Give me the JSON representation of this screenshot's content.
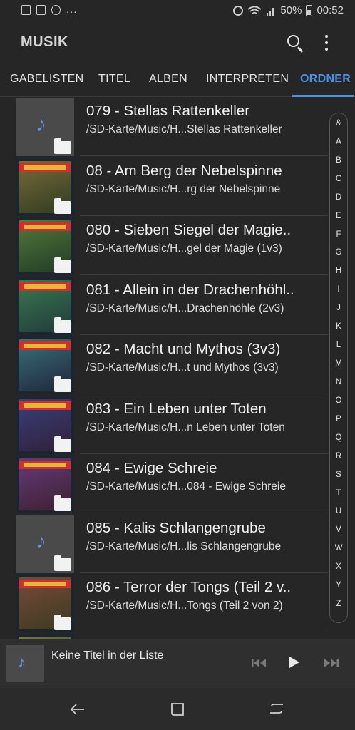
{
  "status_bar": {
    "battery": "50%",
    "time": "00:52",
    "more": "..."
  },
  "app": {
    "title": "MUSIK"
  },
  "tabs": [
    {
      "label": "GABELISTEN"
    },
    {
      "label": "TITEL"
    },
    {
      "label": "ALBEN"
    },
    {
      "label": "INTERPRETEN"
    },
    {
      "label": "ORDNER"
    }
  ],
  "active_tab": "ORDNER",
  "folders": [
    {
      "title": "079 - Stellas Rattenkeller",
      "path": "/SD-Karte/Music/H...Stellas Rattenkeller",
      "art": "note"
    },
    {
      "title": "08 - Am Berg der Nebelspinne",
      "path": "/SD-Karte/Music/H...rg der Nebelspinne",
      "art": "cover"
    },
    {
      "title": "080 - Sieben Siegel der Magie..",
      "path": "/SD-Karte/Music/H...gel der Magie (1v3)",
      "art": "cover"
    },
    {
      "title": "081 - Allein in der Drachenhöhl..",
      "path": "/SD-Karte/Music/H...Drachenhöhle (2v3)",
      "art": "cover"
    },
    {
      "title": "082 - Macht und Mythos (3v3)",
      "path": "/SD-Karte/Music/H...t und Mythos (3v3)",
      "art": "cover"
    },
    {
      "title": "083 - Ein Leben unter Toten",
      "path": "/SD-Karte/Music/H...n Leben unter Toten",
      "art": "cover"
    },
    {
      "title": "084 - Ewige Schreie",
      "path": "/SD-Karte/Music/H...084 - Ewige Schreie",
      "art": "cover"
    },
    {
      "title": "085 - Kalis Schlangengrube",
      "path": "/SD-Karte/Music/H...lis Schlangengrube",
      "art": "note"
    },
    {
      "title": "086 - Terror der Tongs (Teil 2 v..",
      "path": "/SD-Karte/Music/H...Tongs (Teil 2 von 2)",
      "art": "cover"
    },
    {
      "title": "",
      "path": "",
      "art": "cover"
    }
  ],
  "index_letters": [
    "&",
    "A",
    "B",
    "C",
    "D",
    "E",
    "F",
    "G",
    "H",
    "I",
    "J",
    "K",
    "L",
    "M",
    "N",
    "O",
    "P",
    "Q",
    "R",
    "S",
    "T",
    "U",
    "V",
    "W",
    "X",
    "Y",
    "Z"
  ],
  "player": {
    "text": "Keine Titel in der Liste"
  },
  "colors": {
    "accent": "#4f8fe6",
    "background": "#262626",
    "note_icon": "#6b8fe8"
  }
}
